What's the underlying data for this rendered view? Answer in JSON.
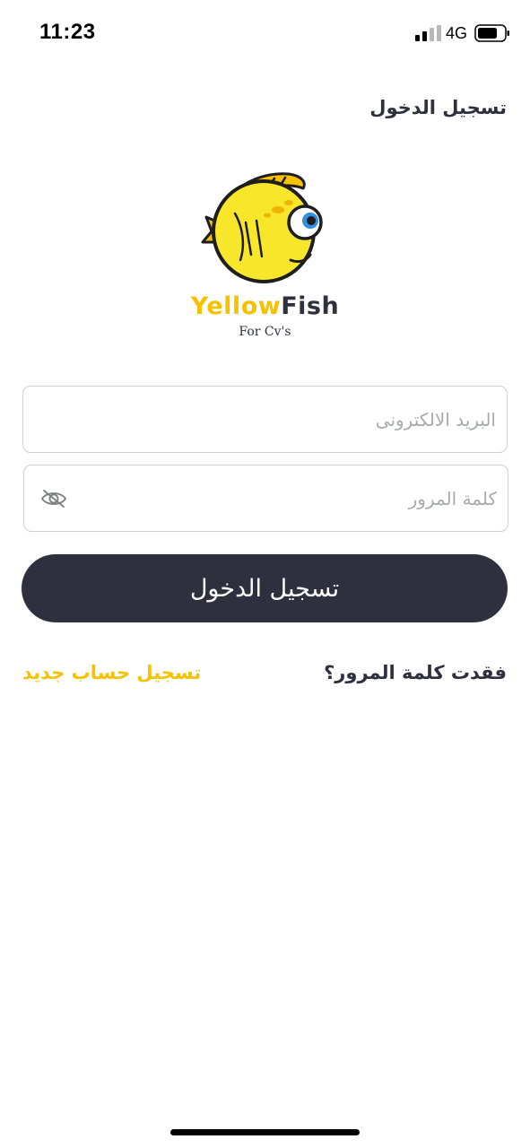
{
  "status_bar": {
    "time": "11:23",
    "network": "4G"
  },
  "header": {
    "title": "تسجيل الدخول"
  },
  "logo": {
    "word_yellow": "Yellow",
    "word_dark": "Fish",
    "subtitle": "For Cv's"
  },
  "form": {
    "email_placeholder": "البريد الالكترونى",
    "email_value": "",
    "password_placeholder": "كلمة المرور",
    "password_value": "",
    "login_label": "تسجيل الدخول"
  },
  "links": {
    "forgot_password": "فقدت كلمة المرور؟",
    "register": "تسجيل حساب جديد"
  },
  "icons": {
    "signal": "signal-icon",
    "battery": "battery-icon",
    "eye": "eye-off-icon",
    "fish": "fish-logo"
  },
  "colors": {
    "brand_yellow": "#f5c200",
    "dark": "#2e303d",
    "placeholder": "#a8a9ae",
    "border": "#cfd0d4"
  }
}
